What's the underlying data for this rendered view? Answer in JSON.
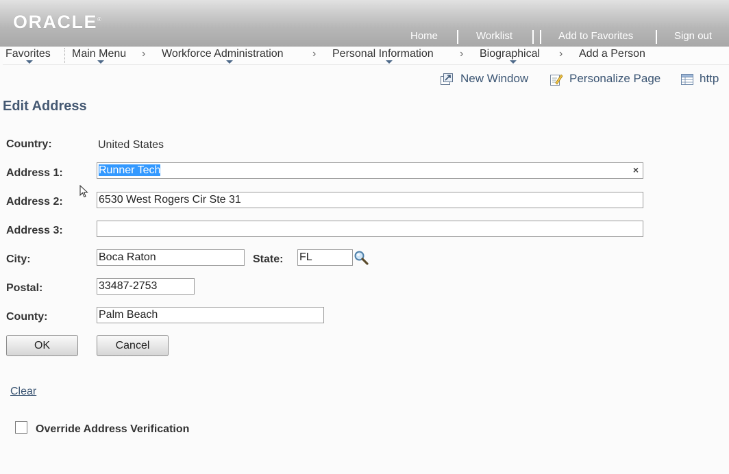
{
  "header": {
    "logo": "ORACLE",
    "links": {
      "home": "Home",
      "worklist": "Worklist",
      "add_to_favorites": "Add to Favorites",
      "sign_out": "Sign out"
    }
  },
  "nav": {
    "favorites": "Favorites",
    "main_menu": "Main Menu",
    "workforce_admin": "Workforce Administration",
    "personal_info": "Personal Information",
    "biographical": "Biographical",
    "add_person": "Add a Person",
    "chevron": "›"
  },
  "tools": {
    "new_window": "New Window",
    "personalize_page": "Personalize Page",
    "http": "http"
  },
  "page": {
    "title": "Edit Address"
  },
  "form": {
    "country_label": "Country:",
    "country_value": "United States",
    "address1_label": "Address 1:",
    "address1_value": "Runner Tech",
    "address2_label": "Address 2:",
    "address2_value": "6530 West Rogers Cir Ste 31",
    "address3_label": "Address 3:",
    "address3_value": "",
    "city_label": "City:",
    "city_value": "Boca Raton",
    "state_label": "State:",
    "state_value": "FL",
    "postal_label": "Postal:",
    "postal_value": "33487-2753",
    "county_label": "County:",
    "county_value": "Palm Beach",
    "clear_x": "×"
  },
  "buttons": {
    "ok": "OK",
    "cancel": "Cancel"
  },
  "links": {
    "clear": "Clear"
  },
  "override": {
    "label": "Override Address Verification",
    "checked": false
  },
  "colors": {
    "accent_blue": "#445872",
    "link_blue": "#3b5573",
    "selection": "#3399ff"
  }
}
